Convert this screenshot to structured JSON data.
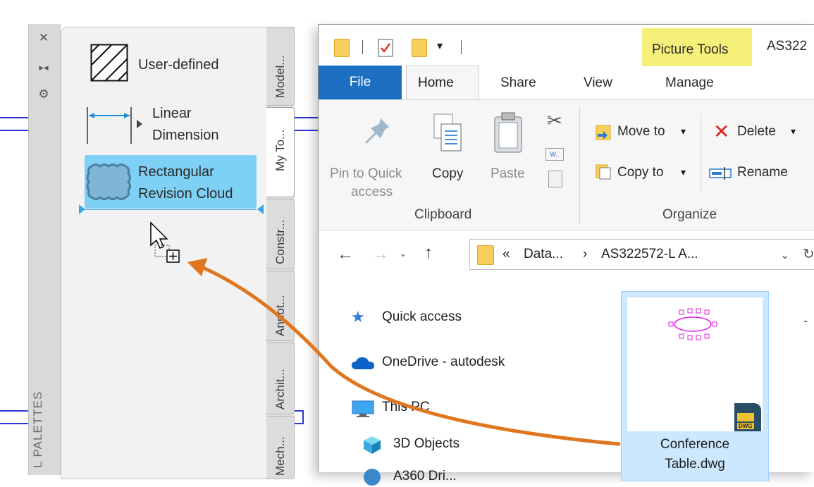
{
  "palette": {
    "title": "L PALETTES",
    "controls": [
      "close-icon",
      "auto-hide-icon",
      "properties-icon"
    ],
    "tools": [
      {
        "label": "User-defined",
        "icon": "hatch-icon"
      },
      {
        "label_line1": "Linear",
        "label_line2": "Dimension",
        "icon": "linear-dimension-icon"
      },
      {
        "label_line1": "Rectangular",
        "label_line2": "Revision Cloud",
        "icon": "revision-cloud-icon",
        "selected": true
      }
    ],
    "tabs": [
      "Model...",
      "My To...",
      "Constr...",
      "Annot...",
      "Archit...",
      "Mech..."
    ],
    "active_tab": "My To..."
  },
  "explorer": {
    "title_fragment": "AS322",
    "contextual_tab_group": "Picture Tools",
    "tabs": [
      "File",
      "Home",
      "Share",
      "View",
      "Manage"
    ],
    "ribbon": {
      "clipboard": {
        "group_label": "Clipboard",
        "pin_label_line1": "Pin to Quick",
        "pin_label_line2": "access",
        "copy_label": "Copy",
        "paste_label": "Paste"
      },
      "organize": {
        "group_label": "Organize",
        "move_to": "Move to",
        "copy_to": "Copy to",
        "delete": "Delete",
        "rename": "Rename"
      }
    },
    "address": {
      "prefix": "«",
      "crumb1": "Data...",
      "separator": "›",
      "crumb2": "AS322572-L A..."
    },
    "nav_pane": [
      "Quick access",
      "OneDrive - autodesk",
      "This PC",
      "3D Objects",
      "A360 Dri..."
    ],
    "file": {
      "name_line1": "Conference",
      "name_line2": "Table.dwg",
      "badge": "DWG"
    }
  },
  "colors": {
    "drag_arrow": "#e0761e",
    "selection_blue": "#7ed0f5",
    "file_tab_blue": "#1c6fc1",
    "picture_tools_yellow": "#f5f07a",
    "cad_line_blue": "#2a36d6"
  }
}
